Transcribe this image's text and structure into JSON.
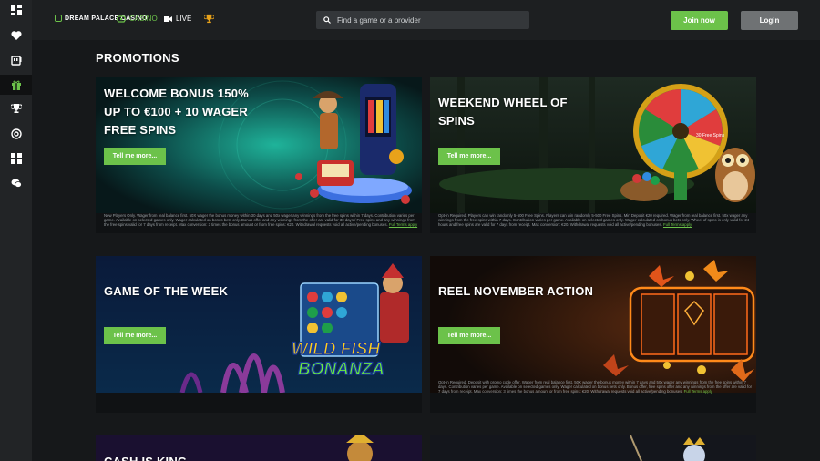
{
  "sidebar": {
    "items": [
      {
        "icon": "dashboard-icon"
      },
      {
        "icon": "heart-icon"
      },
      {
        "icon": "slot-machine-icon"
      },
      {
        "icon": "gift-icon"
      },
      {
        "icon": "trophy-icon"
      },
      {
        "icon": "target-icon"
      },
      {
        "icon": "grid-icon"
      },
      {
        "icon": "chat-icon"
      }
    ],
    "active_index": 3
  },
  "header": {
    "logo": "DREAM PALACE CASINO",
    "nav": {
      "casino": "CASINO",
      "live": "LIVE"
    },
    "search_placeholder": "Find a game or a provider",
    "join_label": "Join now",
    "login_label": "Login"
  },
  "colors": {
    "accent": "#6cc24a",
    "background": "#16181a",
    "topbar": "#1d1f21"
  },
  "page_title": "PROMOTIONS",
  "promotions": [
    {
      "title_lines": [
        "WELCOME BONUS 150%",
        "UP TO €100 + 10 WAGER",
        "FREE SPINS"
      ],
      "button": "Tell me more...",
      "terms": "New Players Only. Wager from real balance first. 50X wager the bonus money within 30 days and 50x wager any winnings from the free spins within 7 days. Contribution varies per game. Available on selected games only. Wager calculated on bonus bets only. Bonus offer and any winnings from the offer are valid for 30 days / Free spins and any winnings from the free spins valid for 7 days from receipt. Max conversion: 3 times the bonus amount or from free spins: €20. Withdrawal requests void all active/pending bonuses.",
      "terms_link": "Full Terms apply"
    },
    {
      "title_lines": [
        "WEEKEND WHEEL OF",
        "SPINS"
      ],
      "button": "Tell me more...",
      "terms": "Opt-in Required. Players can win randomly 5-500 Free Spins. Players can win randomly 5-500 Free Spins. Min Deposit €20 required. Wager from real balance first. 50x wager any winnings from the free spins within 7 days. Contribution varies per game. Available on selected games only. Wager calculated on bonus bets only. Wheel of spins is only valid for 24 hours and free spins are valid for 7 days from receipt. Max conversion: €20. Withdrawal requests void all active/pending bonuses.",
      "terms_link": "Full Terms apply"
    },
    {
      "title_lines": [
        "GAME OF THE WEEK"
      ],
      "button": "Tell me more...",
      "terms": "",
      "terms_link": ""
    },
    {
      "title_lines": [
        "REEL NOVEMBER ACTION"
      ],
      "button": "Tell me more...",
      "terms": "Opt-in Required. Deposit with promo code offer. Wager from real balance first. 50X wager the bonus money within 7 days and 50x wager any winnings from the free spins within 7 days. Contribution varies per game. Available on selected games only. Wager calculated on bonus bets only. Bonus offer, free spins offer and any winnings from the offer are valid for 7 days from receipt. Max conversion: 3 times the bonus amount or from free spins: €20. Withdrawal requests void all active/pending bonuses.",
      "terms_link": "Full Terms apply"
    },
    {
      "title_lines": [
        "CASH IS KING"
      ]
    }
  ],
  "game_art": {
    "wild_fish_line1": "WILD FISH",
    "wild_fish_line2": "BONANZA",
    "wheel_label": "30 Free Spins"
  }
}
